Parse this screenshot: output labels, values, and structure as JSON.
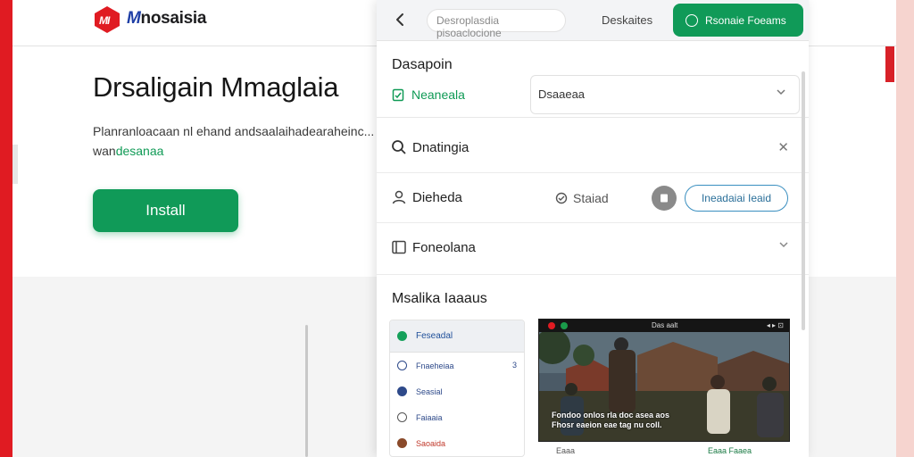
{
  "page": {
    "brand_mark": "M",
    "brand_rest": "nosaisia",
    "hero_title": "Drsaligain Mmaglaia",
    "hero_desc_line1": "Planranloacaan nl ehand andsaalaihadearaheinc...",
    "hero_desc_line2_prefix": "wan",
    "hero_desc_line2_link": "desanaa",
    "install_label": "Install"
  },
  "panel": {
    "search_placeholder": "Desroplasdia pisoaclocione",
    "nav_link": "Deskaites",
    "cta_label": "Rsonaie Foeams",
    "card_title": "Dasapoin",
    "card_link": "Neaneala",
    "select_value": "Dsaaeaa",
    "search_row_label": "Dnatingia",
    "user_row_label": "Dieheda",
    "status_label": "Staiad",
    "outline_button": "Ineadaiai  Ieaid",
    "folder_row_label": "Foneolana",
    "media_title": "Msalika Iaaaus",
    "mini_items": [
      {
        "label": "Feseadal",
        "badge": ""
      },
      {
        "label": "Fnaeheiaa",
        "badge": "3"
      },
      {
        "label": "Seasial",
        "badge": ""
      },
      {
        "label": "Faiaaia",
        "badge": ""
      },
      {
        "label": "Saoaida",
        "badge": ""
      }
    ],
    "video_top": "Das aalt",
    "video_caption_1": "Fondoo onlos rla doc asea aos",
    "video_caption_2": "Fhosr eaeion eae tag nu coll.",
    "video_foot_left": "Eaaa",
    "video_foot_right": "Eaaa Faaea"
  },
  "colors": {
    "brand_red": "#e01b22",
    "primary_green": "#109a58",
    "link_green": "#0f9a55",
    "outline_blue": "#3a8fc0",
    "brand_blue": "#1f3fa6"
  },
  "icons": [
    "back-arrow-icon",
    "logo-icon",
    "check-circle-icon",
    "clipboard-icon",
    "chevron-down-icon",
    "search-icon",
    "close-icon",
    "user-icon",
    "status-icon",
    "file-icon",
    "folder-icon"
  ]
}
